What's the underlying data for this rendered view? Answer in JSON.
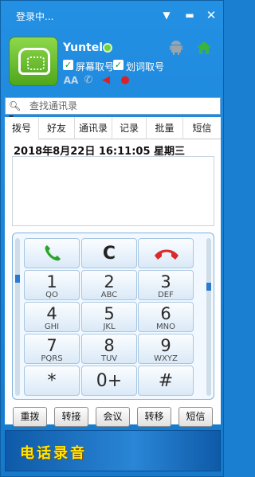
{
  "window": {
    "title": "登录中..."
  },
  "profile": {
    "username": "Yuntel",
    "options": [
      "屏幕取号",
      "划词取号"
    ],
    "status_icons": [
      "aa-icon",
      "phone-icon",
      "speaker-mute-icon",
      "mic-mute-icon"
    ]
  },
  "search": {
    "placeholder": "查找通讯录"
  },
  "tabs": [
    "拨号",
    "好友",
    "通讯录",
    "记录",
    "批量",
    "短信"
  ],
  "dial": {
    "datetime": "2018年8月22日 16:11:05 星期三",
    "number": ""
  },
  "keypad": {
    "top_row": {
      "clear": "C"
    },
    "keys": [
      {
        "num": "1",
        "sub": "QO"
      },
      {
        "num": "2",
        "sub": "ABC"
      },
      {
        "num": "3",
        "sub": "DEF"
      },
      {
        "num": "4",
        "sub": "GHI"
      },
      {
        "num": "5",
        "sub": "JKL"
      },
      {
        "num": "6",
        "sub": "MNO"
      },
      {
        "num": "7",
        "sub": "PQRS"
      },
      {
        "num": "8",
        "sub": "TUV"
      },
      {
        "num": "9",
        "sub": "WXYZ"
      },
      {
        "num": "*",
        "sub": ""
      },
      {
        "num": "0+",
        "sub": ""
      },
      {
        "num": "#",
        "sub": ""
      }
    ]
  },
  "actions": [
    "重拨",
    "转接",
    "会议",
    "转移",
    "短信"
  ],
  "banner": {
    "text": "电话录音"
  },
  "colors": {
    "accent": "#1a7fd0",
    "call_green": "#2aa52a",
    "hangup_red": "#d92b2b",
    "banner_text": "#ffe600"
  }
}
